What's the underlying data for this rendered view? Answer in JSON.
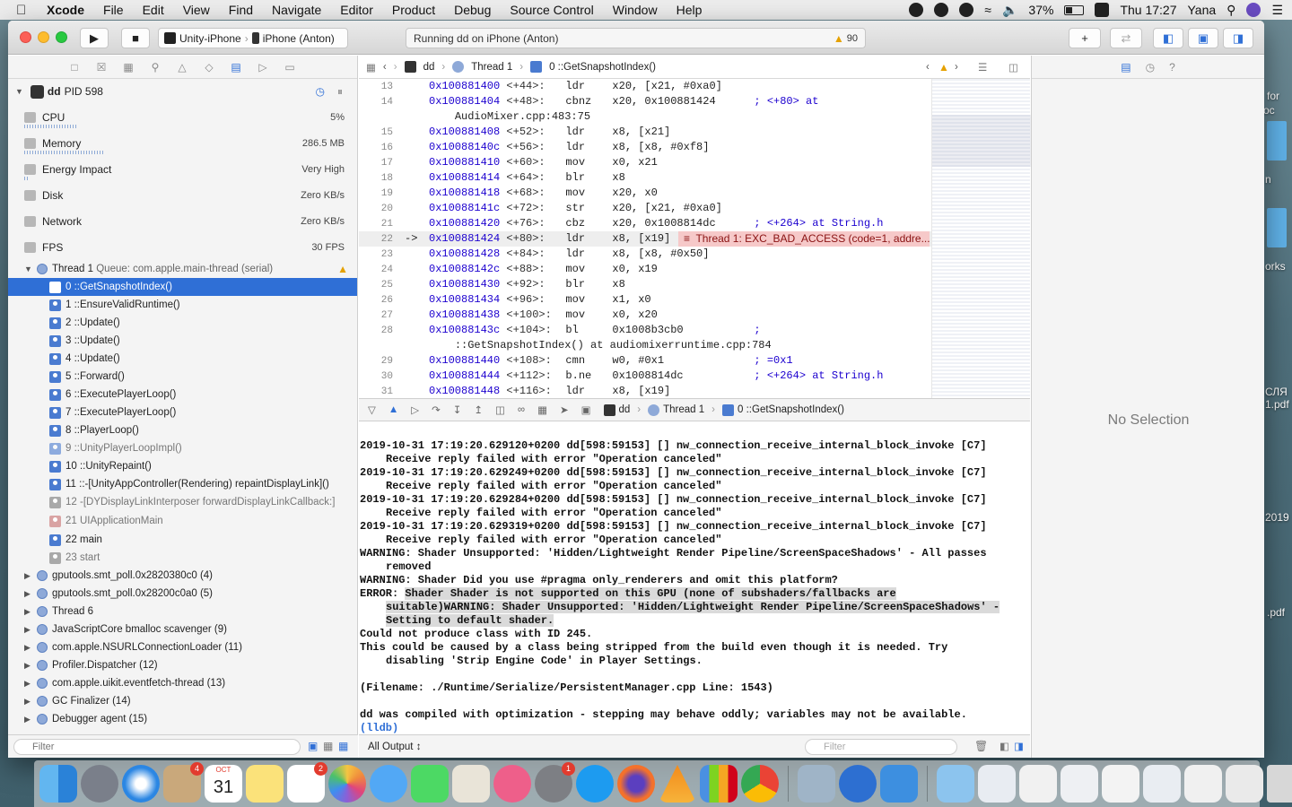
{
  "menubar": {
    "app_name": "Xcode",
    "items": [
      "File",
      "Edit",
      "View",
      "Find",
      "Navigate",
      "Editor",
      "Product",
      "Debug",
      "Source Control",
      "Window",
      "Help"
    ],
    "battery": "37%",
    "clock": "Thu 17:27",
    "user": "Yana"
  },
  "toolbar": {
    "scheme_target": "Unity-iPhone",
    "scheme_device": "iPhone (Anton)",
    "activity_text": "Running dd on iPhone (Anton)",
    "warning_count": "90"
  },
  "navigator": {
    "process": {
      "name": "dd",
      "pid": "PID 598"
    },
    "gauges": [
      {
        "label": "CPU",
        "value": "5%"
      },
      {
        "label": "Memory",
        "value": "286.5 MB"
      },
      {
        "label": "Energy Impact",
        "value": "Very High"
      },
      {
        "label": "Disk",
        "value": "Zero KB/s"
      },
      {
        "label": "Network",
        "value": "Zero KB/s"
      },
      {
        "label": "FPS",
        "value": "30 FPS"
      }
    ],
    "thread1": {
      "name": "Thread 1",
      "queue": "Queue: com.apple.main-thread (serial)"
    },
    "frames": [
      "0 ::GetSnapshotIndex()",
      "1 ::EnsureValidRuntime()",
      "2 ::Update()",
      "3 ::Update()",
      "4 ::Update()",
      "5 ::Forward()",
      "6 ::ExecutePlayerLoop()",
      "7 ::ExecutePlayerLoop()",
      "8 ::PlayerLoop()",
      "9 ::UnityPlayerLoopImpl()",
      "10 ::UnityRepaint()",
      "11 ::-[UnityAppController(Rendering) repaintDisplayLink]()",
      "12 -[DYDisplayLinkInterposer forwardDisplayLinkCallback:]",
      "21 UIApplicationMain",
      "22 main",
      "23 start"
    ],
    "threads": [
      "gputools.smt_poll.0x2820380c0 (4)",
      "gputools.smt_poll.0x28200c0a0 (5)",
      "Thread 6",
      "JavaScriptCore bmalloc scavenger (9)",
      "com.apple.NSURLConnectionLoader (11)",
      "Profiler.Dispatcher (12)",
      "com.apple.uikit.eventfetch-thread (13)",
      "GC Finalizer (14)",
      "Debugger agent (15)"
    ],
    "filter_placeholder": "Filter"
  },
  "jumpbar": {
    "target": "dd",
    "thread": "Thread 1",
    "frame": "0 ::GetSnapshotIndex()"
  },
  "code": {
    "lines": [
      {
        "n": "13",
        "arrow": "",
        "addr": "0x100881400",
        "off": "<+44>:",
        "op": "ldr",
        "args": "x20, [x21, #0xa0]",
        "cmt": ""
      },
      {
        "n": "14",
        "arrow": "",
        "addr": "0x100881404",
        "off": "<+48>:",
        "op": "cbnz",
        "args": "x20, 0x100881424",
        "cmt": "; <+80> at"
      },
      {
        "n": "",
        "arrow": "",
        "addr": "",
        "off": "",
        "op": "",
        "args": "",
        "cmt": "AudioMixer.cpp:483:75",
        "cont": true
      },
      {
        "n": "15",
        "arrow": "",
        "addr": "0x100881408",
        "off": "<+52>:",
        "op": "ldr",
        "args": "x8, [x21]",
        "cmt": ""
      },
      {
        "n": "16",
        "arrow": "",
        "addr": "0x10088140c",
        "off": "<+56>:",
        "op": "ldr",
        "args": "x8, [x8, #0xf8]",
        "cmt": ""
      },
      {
        "n": "17",
        "arrow": "",
        "addr": "0x100881410",
        "off": "<+60>:",
        "op": "mov",
        "args": "x0, x21",
        "cmt": ""
      },
      {
        "n": "18",
        "arrow": "",
        "addr": "0x100881414",
        "off": "<+64>:",
        "op": "blr",
        "args": "x8",
        "cmt": ""
      },
      {
        "n": "19",
        "arrow": "",
        "addr": "0x100881418",
        "off": "<+68>:",
        "op": "mov",
        "args": "x20, x0",
        "cmt": ""
      },
      {
        "n": "20",
        "arrow": "",
        "addr": "0x10088141c",
        "off": "<+72>:",
        "op": "str",
        "args": "x20, [x21, #0xa0]",
        "cmt": ""
      },
      {
        "n": "21",
        "arrow": "",
        "addr": "0x100881420",
        "off": "<+76>:",
        "op": "cbz",
        "args": "x20, 0x1008814dc",
        "cmt": "; <+264> at String.h"
      },
      {
        "n": "22",
        "arrow": "->",
        "addr": "0x100881424",
        "off": "<+80>:",
        "op": "ldr",
        "args": "x8, [x19]",
        "cmt": "",
        "pc": true
      },
      {
        "n": "23",
        "arrow": "",
        "addr": "0x100881428",
        "off": "<+84>:",
        "op": "ldr",
        "args": "x8, [x8, #0x50]",
        "cmt": ""
      },
      {
        "n": "24",
        "arrow": "",
        "addr": "0x10088142c",
        "off": "<+88>:",
        "op": "mov",
        "args": "x0, x19",
        "cmt": ""
      },
      {
        "n": "25",
        "arrow": "",
        "addr": "0x100881430",
        "off": "<+92>:",
        "op": "blr",
        "args": "x8",
        "cmt": ""
      },
      {
        "n": "26",
        "arrow": "",
        "addr": "0x100881434",
        "off": "<+96>:",
        "op": "mov",
        "args": "x1, x0",
        "cmt": ""
      },
      {
        "n": "27",
        "arrow": "",
        "addr": "0x100881438",
        "off": "<+100>:",
        "op": "mov",
        "args": "x0, x20",
        "cmt": ""
      },
      {
        "n": "28",
        "arrow": "",
        "addr": "0x10088143c",
        "off": "<+104>:",
        "op": "bl",
        "args": "0x1008b3cb0",
        "cmt": ";"
      },
      {
        "n": "",
        "arrow": "",
        "addr": "",
        "off": "",
        "op": "",
        "args": "",
        "cmt": "::GetSnapshotIndex() at audiomixerruntime.cpp:784",
        "cont": true
      },
      {
        "n": "29",
        "arrow": "",
        "addr": "0x100881440",
        "off": "<+108>:",
        "op": "cmn",
        "args": "w0, #0x1",
        "cmt": "; =0x1"
      },
      {
        "n": "30",
        "arrow": "",
        "addr": "0x100881444",
        "off": "<+112>:",
        "op": "b.ne",
        "args": "0x1008814dc",
        "cmt": "; <+264> at String.h"
      },
      {
        "n": "31",
        "arrow": "",
        "addr": "0x100881448",
        "off": "<+116>:",
        "op": "ldr",
        "args": "x8, [x19]",
        "cmt": ""
      }
    ],
    "error_banner": "Thread 1: EXC_BAD_ACCESS (code=1, addre..."
  },
  "debugbar": {
    "target": "dd",
    "thread": "Thread 1",
    "frame": "0 ::GetSnapshotIndex()"
  },
  "console": {
    "lines": [
      {
        "t": "2019-10-31 17:19:20.629120+0200 dd[598:59153] [] nw_connection_receive_internal_block_invoke [C7]",
        "ind": false
      },
      {
        "t": "Receive reply failed with error \"Operation canceled\"",
        "ind": true
      },
      {
        "t": "2019-10-31 17:19:20.629249+0200 dd[598:59153] [] nw_connection_receive_internal_block_invoke [C7]",
        "ind": false
      },
      {
        "t": "Receive reply failed with error \"Operation canceled\"",
        "ind": true
      },
      {
        "t": "2019-10-31 17:19:20.629284+0200 dd[598:59153] [] nw_connection_receive_internal_block_invoke [C7]",
        "ind": false
      },
      {
        "t": "Receive reply failed with error \"Operation canceled\"",
        "ind": true
      },
      {
        "t": "2019-10-31 17:19:20.629319+0200 dd[598:59153] [] nw_connection_receive_internal_block_invoke [C7]",
        "ind": false
      },
      {
        "t": "Receive reply failed with error \"Operation canceled\"",
        "ind": true
      },
      {
        "t": "WARNING: Shader Unsupported: 'Hidden/Lightweight Render Pipeline/ScreenSpaceShadows' - All passes",
        "ind": false
      },
      {
        "t": "removed",
        "ind": true
      },
      {
        "t": "WARNING: Shader Did you use #pragma only_renderers and omit this platform?",
        "ind": false
      },
      {
        "t": "ERROR: ",
        "hl": "Shader Shader is not supported on this GPU (none of subshaders/fallbacks are",
        "ind": false
      },
      {
        "t": "",
        "hl": "suitable)WARNING: Shader Unsupported: 'Hidden/Lightweight Render Pipeline/ScreenSpaceShadows' -",
        "ind": true
      },
      {
        "t": "",
        "hl": "Setting to default shader.",
        "ind": true
      },
      {
        "t": "Could not produce class with ID 245.",
        "ind": false
      },
      {
        "t": "This could be caused by a class being stripped from the build even though it is needed. Try",
        "ind": false
      },
      {
        "t": "disabling 'Strip Engine Code' in Player Settings.",
        "ind": true
      },
      {
        "t": " ",
        "ind": false
      },
      {
        "t": "(Filename: ./Runtime/Serialize/PersistentManager.cpp Line: 1543)",
        "ind": false
      },
      {
        "t": " ",
        "ind": false
      },
      {
        "t": "dd was compiled with optimization - stepping may behave oddly; variables may not be available.",
        "ind": false
      }
    ],
    "prompt": "(lldb)",
    "output_selector": "All Output ↕",
    "filter_placeholder": "Filter"
  },
  "inspector": {
    "empty_text": "No Selection"
  },
  "desktop": {
    "labels": [
      "for",
      "ос",
      "n",
      "orks",
      "СЛЯ",
      "1.pdf",
      "2019",
      ".pdf"
    ]
  },
  "dock": {
    "badges": {
      "mail": "4",
      "reminders": "2",
      "prefs": "1"
    },
    "calendar_month": "OCT",
    "calendar_day": "31"
  }
}
